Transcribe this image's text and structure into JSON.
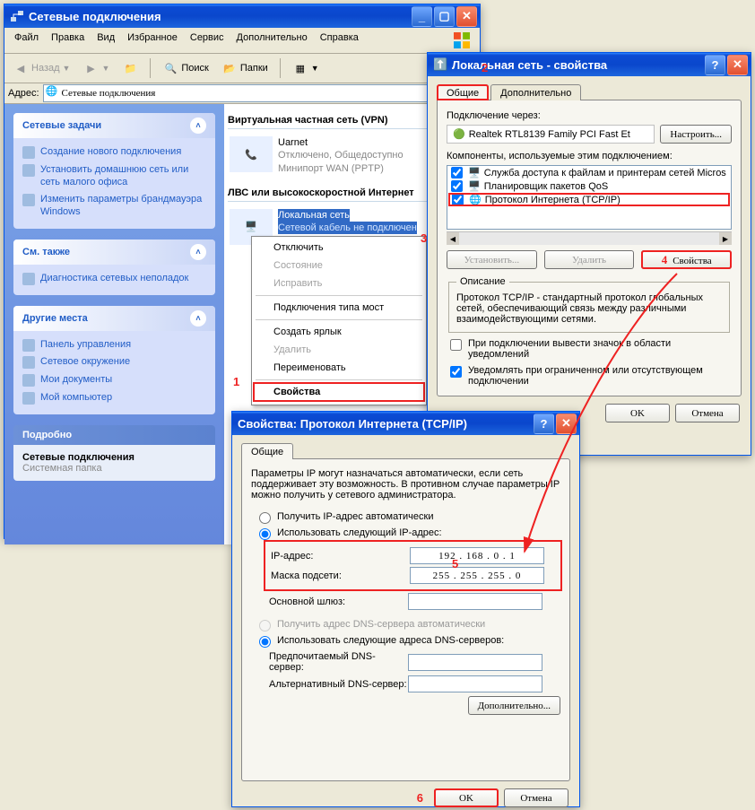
{
  "main": {
    "title": "Сетевые подключения",
    "menu": [
      "Файл",
      "Правка",
      "Вид",
      "Избранное",
      "Сервис",
      "Дополнительно",
      "Справка"
    ],
    "tb": {
      "back": "Назад",
      "search": "Поиск",
      "folders": "Папки"
    },
    "addr_label": "Адрес:",
    "addr_value": "Сетевые подключения",
    "tasks": {
      "hdr": "Сетевые задачи",
      "items": [
        "Создание нового подключения",
        "Установить домашнюю сеть или сеть малого офиса",
        "Изменить параметры брандмауэра Windows"
      ]
    },
    "see": {
      "hdr": "См. также",
      "items": [
        "Диагностика сетевых неполадок"
      ]
    },
    "other": {
      "hdr": "Другие места",
      "items": [
        "Панель управления",
        "Сетевое окружение",
        "Мои документы",
        "Мой компьютер"
      ]
    },
    "detail": {
      "hdr": "Подробно",
      "title": "Сетевые подключения",
      "sub": "Системная папка"
    },
    "grp_vpn": "Виртуальная частная сеть (VPN)",
    "grp_lan": "ЛВС или высокоскоростной Интернет",
    "uarnet": {
      "name": "Uarnet",
      "l2": "Отключено, Общедоступно",
      "l3": "Минипорт WAN (PPTP)"
    },
    "lan": {
      "name": "Локальная сеть",
      "l2": "Сетевой кабель не подключен"
    }
  },
  "ctx": {
    "disable": "Отключить",
    "status": "Состояние",
    "repair": "Исправить",
    "bridge": "Подключения типа мост",
    "shortcut": "Создать ярлык",
    "delete": "Удалить",
    "rename": "Переименовать",
    "props": "Свойства"
  },
  "lan_dlg": {
    "title": "Локальная сеть - свойства",
    "tab_general": "Общие",
    "tab_adv": "Дополнительно",
    "connect_via": "Подключение через:",
    "adapter": "Realtek RTL8139 Family PCI Fast Et",
    "configure": "Настроить...",
    "components": "Компоненты, используемые этим подключением:",
    "comp": [
      "Служба доступа к файлам и принтерам сетей Micros",
      "Планировщик пакетов QoS",
      "Протокол Интернета (TCP/IP)"
    ],
    "install": "Установить...",
    "remove": "Удалить",
    "props": "Свойства",
    "desc_hdr": "Описание",
    "desc": "Протокол TCP/IP - стандартный протокол глобальных сетей, обеспечивающий связь между различными взаимодействующими сетями.",
    "tray": "При подключении вывести значок в области уведомлений",
    "notify": "Уведомлять при ограниченном или отсутствующем подключении",
    "ok": "OK",
    "cancel": "Отмена"
  },
  "tcpip": {
    "title": "Свойства: Протокол Интернета (TCP/IP)",
    "tab_general": "Общие",
    "intro": "Параметры IP могут назначаться автоматически, если сеть поддерживает эту возможность. В противном случае параметры IP можно получить у сетевого администратора.",
    "auto_ip": "Получить IP-адрес автоматически",
    "manual_ip": "Использовать следующий IP-адрес:",
    "lbl_ip": "IP-адрес:",
    "lbl_mask": "Маска подсети:",
    "lbl_gw": "Основной шлюз:",
    "ip": "192 . 168 .  0  .  1",
    "mask": "255 . 255 . 255 .  0",
    "gw": "",
    "auto_dns": "Получить адрес DNS-сервера автоматически",
    "manual_dns": "Использовать следующие адреса DNS-серверов:",
    "lbl_dns1": "Предпочитаемый DNS-сервер:",
    "lbl_dns2": "Альтернативный DNS-сервер:",
    "dns1": "",
    "dns2": "",
    "advanced": "Дополнительно...",
    "ok": "OK",
    "cancel": "Отмена"
  },
  "steps": {
    "s1": "1",
    "s2": "2",
    "s3": "3",
    "s4": "4",
    "s5": "5",
    "s6": "6"
  }
}
